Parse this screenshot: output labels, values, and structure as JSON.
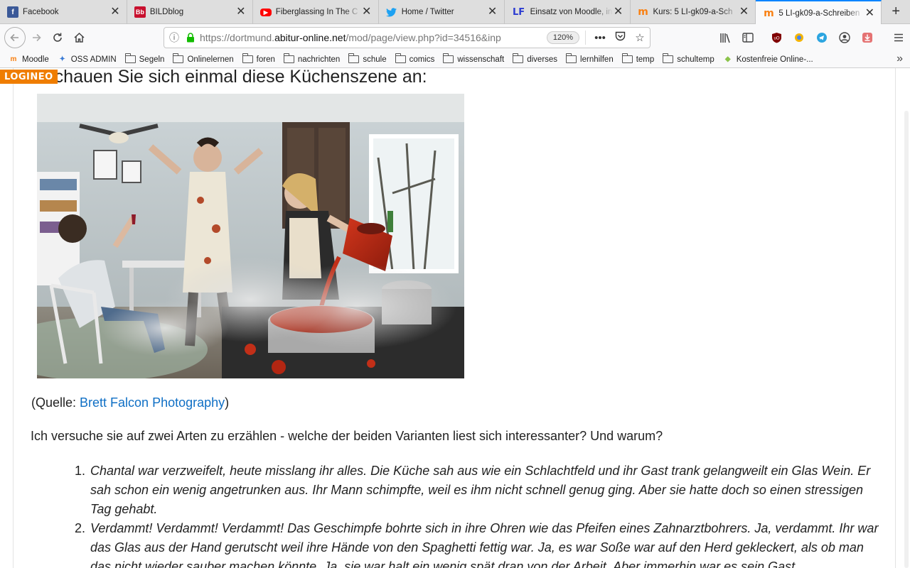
{
  "tabs": [
    {
      "title": "Facebook",
      "icon": "facebook-icon",
      "close": "✕",
      "favicon_text": "f",
      "favicon_color": "#3b5998"
    },
    {
      "title": "BILDblog",
      "icon": "bildblog-icon",
      "close": "✕",
      "favicon_text": "Bb",
      "favicon_color": "#c8102e"
    },
    {
      "title": "Fiberglassing In The C",
      "icon": "youtube-icon",
      "close": "✕",
      "favicon_text": "▶",
      "favicon_color": "#ff0000"
    },
    {
      "title": "Home / Twitter",
      "icon": "twitter-icon",
      "close": "✕",
      "favicon_text": "🐦",
      "favicon_color": "#1da1f2"
    },
    {
      "title": "Einsatz von Moodle, in",
      "icon": "lf-icon",
      "close": "✕",
      "favicon_text": "LF",
      "favicon_color": "#2b3bd1"
    },
    {
      "title": "Kurs: 5 LI-gk09-a-Sch",
      "icon": "moodle-icon",
      "close": "✕",
      "favicon_text": "m",
      "favicon_color": "#f98012"
    },
    {
      "title": "5 LI-gk09-a-Schreiben",
      "icon": "moodle-icon",
      "close": "✕",
      "favicon_text": "m",
      "favicon_color": "#f98012"
    }
  ],
  "newtab_label": "+",
  "navbar": {
    "url_prefix": "https://dortmund.",
    "url_domain": "abitur-online.net",
    "url_suffix": "/mod/page/view.php?id=34516&inp",
    "zoom": "120%",
    "page_actions": "•••"
  },
  "bookmarks": [
    {
      "label": "Moodle",
      "type": "site",
      "icon": "moodle-icon",
      "icon_text": "m",
      "color": "#f98012"
    },
    {
      "label": "OSS ADMIN",
      "type": "site",
      "icon": "oss-admin-icon",
      "icon_text": "✦",
      "color": "#3a7bd5"
    },
    {
      "label": "Segeln",
      "type": "folder"
    },
    {
      "label": "Onlinelernen",
      "type": "folder"
    },
    {
      "label": "foren",
      "type": "folder"
    },
    {
      "label": "nachrichten",
      "type": "folder"
    },
    {
      "label": "schule",
      "type": "folder"
    },
    {
      "label": "comics",
      "type": "folder"
    },
    {
      "label": "wissenschaft",
      "type": "folder"
    },
    {
      "label": "diverses",
      "type": "folder"
    },
    {
      "label": "lernhilfen",
      "type": "folder"
    },
    {
      "label": "temp",
      "type": "folder"
    },
    {
      "label": "schultemp",
      "type": "folder"
    },
    {
      "label": "Kostenfreie Online-...",
      "type": "site",
      "icon": "puzzle-icon",
      "icon_text": "◆",
      "color": "#8bc34a"
    }
  ],
  "page": {
    "brand": "LOGINEO",
    "heading": "Schauen Sie sich einmal diese Küchenszene an:",
    "caption_prefix": "(Quelle: ",
    "caption_link": "Brett Falcon Photography",
    "caption_suffix": ")",
    "intro": "Ich versuche sie auf zwei Arten zu erzählen - welche der beiden Varianten liest sich interessanter? Und warum?",
    "variants": [
      {
        "num": "1.",
        "text": "Chantal war verzweifelt, heute misslang ihr alles. Die Küche sah aus wie ein Schlachtfeld und ihr Gast trank gelangweilt ein Glas Wein. Er sah schon ein wenig angetrunken aus. Ihr Mann schimpfte, weil es ihm nicht schnell genug ging. Aber sie hatte doch so einen stressigen Tag gehabt."
      },
      {
        "num": "2.",
        "text": "Verdammt! Verdammt! Verdammt! Das Geschimpfe bohrte sich in ihre Ohren wie das Pfeifen eines Zahnarztbohrers. Ja, verdammt. Ihr war das Glas aus der Hand gerutscht weil ihre Hände von den Spaghetti fettig war. Ja, es war Soße war auf den Herd gekleckert, als ob man das nicht wieder sauber machen könnte. Ja, sie war halt ein wenig spät dran von der Arbeit. Aber immerhin war es sein Gast."
      }
    ]
  }
}
